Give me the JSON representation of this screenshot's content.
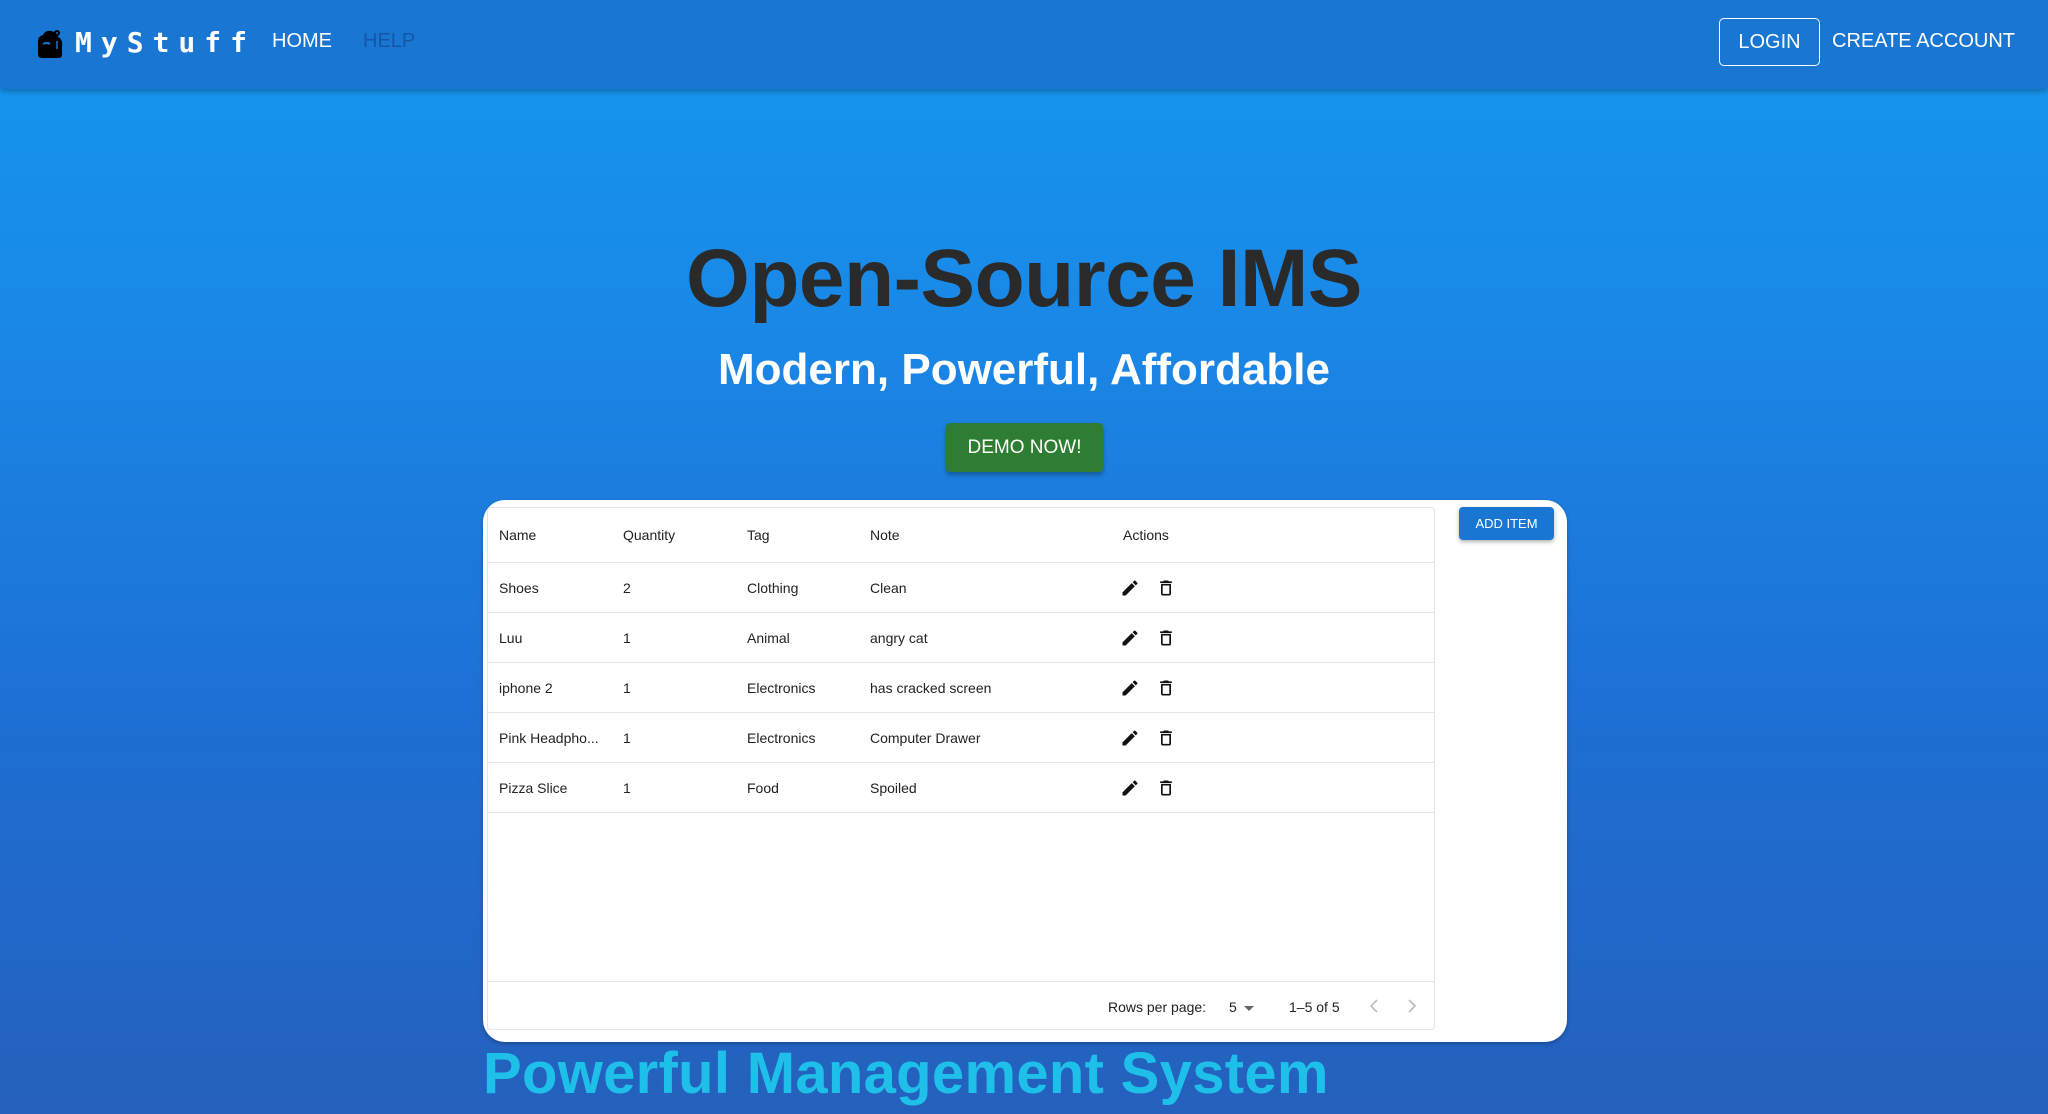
{
  "appbar": {
    "brand": "MyStuff",
    "logo_icon": "backpack-icon",
    "nav": [
      {
        "label": "HOME"
      },
      {
        "label": "HELP"
      }
    ],
    "login_label": "LOGIN",
    "create_account_label": "CREATE ACCOUNT"
  },
  "hero": {
    "title": "Open-Source IMS",
    "subtitle": "Modern, Powerful, Affordable",
    "demo_label": "DEMO NOW!"
  },
  "table": {
    "columns": [
      "Name",
      "Quantity",
      "Tag",
      "Note",
      "Actions"
    ],
    "rows": [
      {
        "name": "Shoes",
        "quantity": "2",
        "tag": "Clothing",
        "note": "Clean"
      },
      {
        "name": "Luu",
        "quantity": "1",
        "tag": "Animal",
        "note": "angry cat"
      },
      {
        "name": "iphone 2",
        "quantity": "1",
        "tag": "Electronics",
        "note": "has cracked screen"
      },
      {
        "name": "Pink Headpho...",
        "quantity": "1",
        "tag": "Electronics",
        "note": "Computer Drawer"
      },
      {
        "name": "Pizza Slice",
        "quantity": "1",
        "tag": "Food",
        "note": "Spoiled"
      }
    ],
    "row_icons": [
      "edit-icon",
      "delete-icon"
    ],
    "pagination": {
      "rows_per_page_label": "Rows per page:",
      "rows_per_page": "5",
      "range": "1–5 of 5"
    }
  },
  "add_item_label": "ADD ITEM",
  "section_title": "Powerful Management System",
  "colors": {
    "appbar": "#1976d2",
    "demo_button": "#2e7d32",
    "add_button": "#1976d2",
    "section_title": "#1ec0ea",
    "title_text": "#2a2a2a"
  }
}
